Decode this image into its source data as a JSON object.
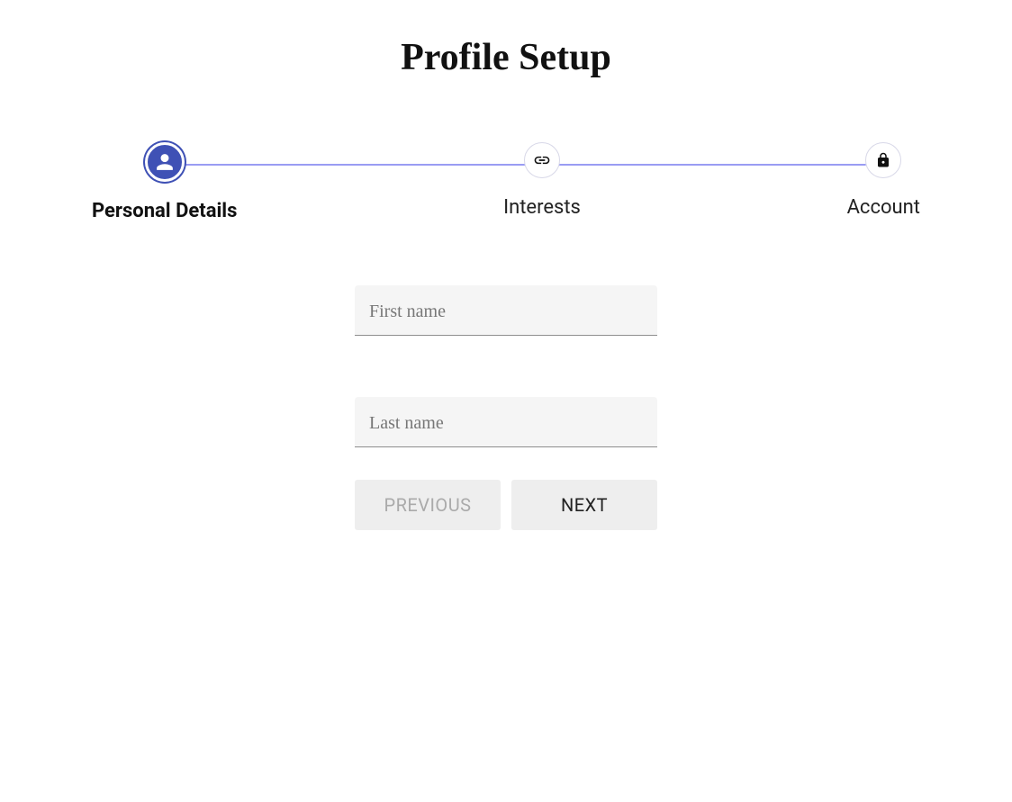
{
  "title": "Profile Setup",
  "stepper": {
    "steps": [
      {
        "label": "Personal Details",
        "icon": "user-icon",
        "active": true
      },
      {
        "label": "Interests",
        "icon": "link-icon",
        "active": false
      },
      {
        "label": "Account",
        "icon": "lock-icon",
        "active": false
      }
    ]
  },
  "form": {
    "first_name_placeholder": "First name",
    "first_name_value": "",
    "last_name_placeholder": "Last name",
    "last_name_value": ""
  },
  "buttons": {
    "previous": "Previous",
    "next": "Next"
  }
}
